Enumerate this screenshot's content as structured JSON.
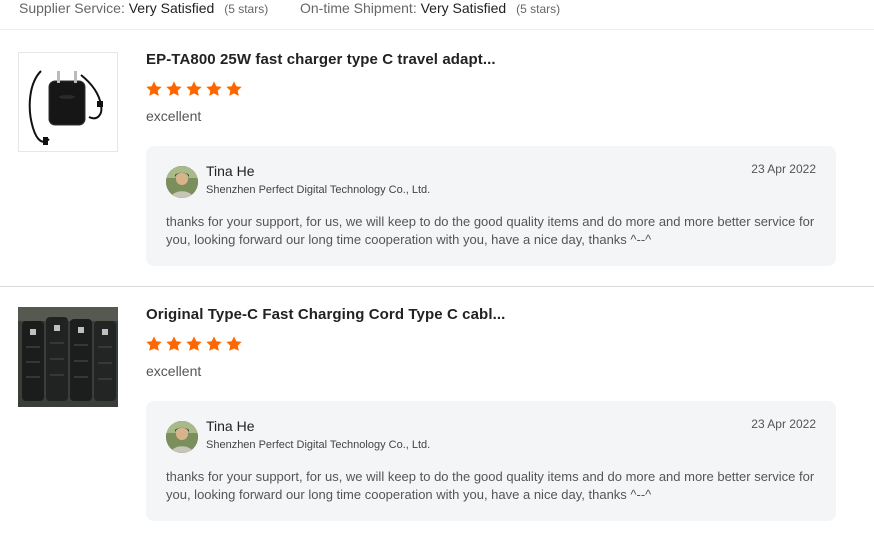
{
  "summary": {
    "supplier_service_label": "Supplier Service:",
    "supplier_service_value": "Very Satisfied",
    "supplier_service_stars": "(5 stars)",
    "ontime_label": "On-time Shipment:",
    "ontime_value": "Very Satisfied",
    "ontime_stars": "(5 stars)"
  },
  "reviews": [
    {
      "product_title": "EP-TA800 25W fast charger type C travel adapt...",
      "rating": 5,
      "rating_color": "#ff6600",
      "text": "excellent",
      "thumbnail_icon": "charger-product-image",
      "reply": {
        "name": "Tina He",
        "company": "Shenzhen Perfect Digital Technology Co., Ltd.",
        "date": "23 Apr 2022",
        "message": "thanks for your support, for us, we will keep to do the good quality items and do more and more better service for you, looking forward our long time cooperation with you, have a nice day, thanks ^--^"
      }
    },
    {
      "product_title": "Original Type-C Fast Charging Cord Type C cabl...",
      "rating": 5,
      "rating_color": "#ff6600",
      "text": "excellent",
      "thumbnail_icon": "cable-product-image",
      "reply": {
        "name": "Tina He",
        "company": "Shenzhen Perfect Digital Technology Co., Ltd.",
        "date": "23 Apr 2022",
        "message": "thanks for your support, for us, we will keep to do the good quality items and do more and more better service for you, looking forward our long time cooperation with you, have a nice day, thanks ^--^"
      }
    }
  ]
}
